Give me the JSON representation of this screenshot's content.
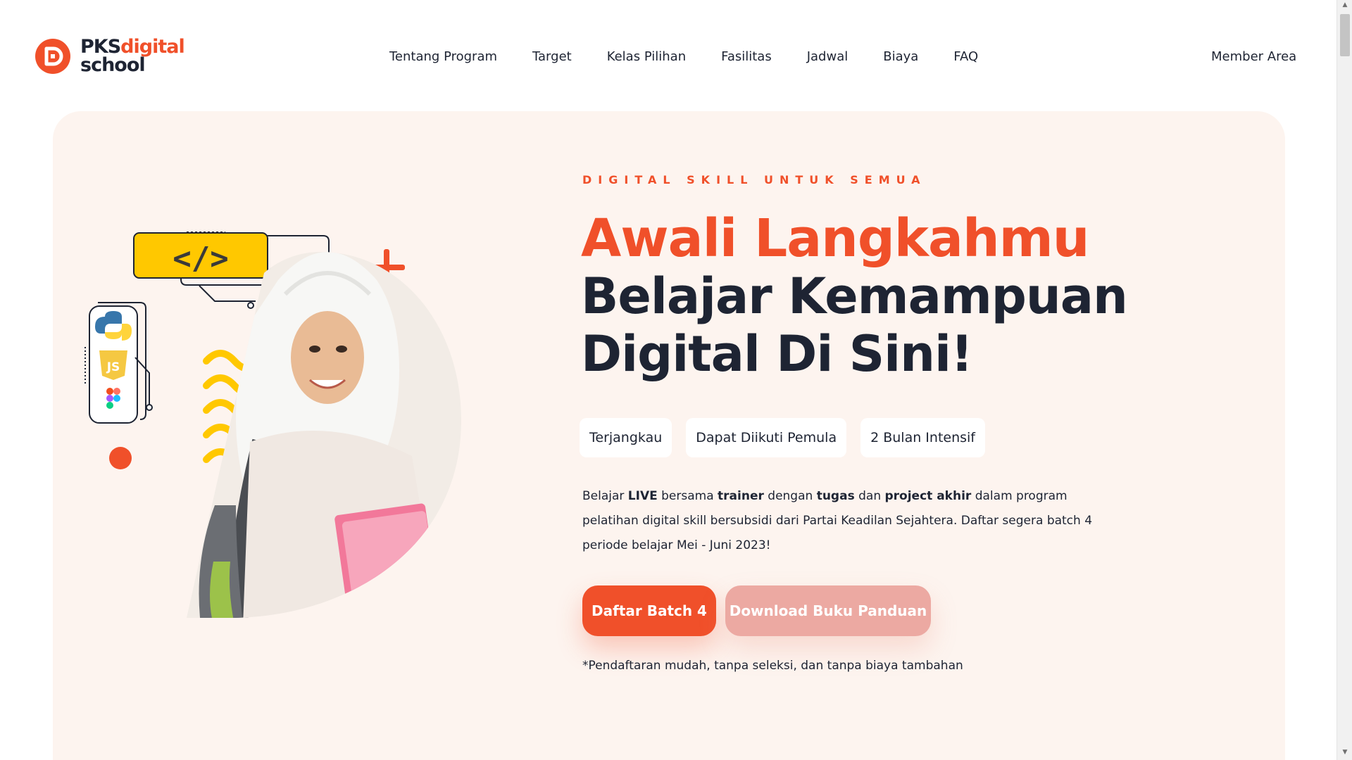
{
  "header": {
    "logo": {
      "line1_a": "PKS",
      "line1_b": "digital",
      "line2": "school"
    },
    "nav": [
      {
        "label": "Tentang Program"
      },
      {
        "label": "Target"
      },
      {
        "label": "Kelas Pilihan"
      },
      {
        "label": "Fasilitas"
      },
      {
        "label": "Jadwal"
      },
      {
        "label": "Biaya"
      },
      {
        "label": "FAQ"
      }
    ],
    "member_area": "Member Area"
  },
  "hero": {
    "eyebrow": "DIGITAL SKILL UNTUK SEMUA",
    "headline_1": "Awali Langkahmu",
    "headline_2": "Belajar Kemampuan",
    "headline_3": "Digital Di Sini!",
    "chips": [
      {
        "label": "Terjangkau"
      },
      {
        "label": "Dapat Diikuti Pemula"
      },
      {
        "label": "2 Bulan Intensif"
      }
    ],
    "description": {
      "t1": "Belajar ",
      "b1": "LIVE",
      "t2": " bersama ",
      "b2": "trainer",
      "t3": " dengan ",
      "b3": "tugas",
      "t4": " dan ",
      "b4": "project akhir",
      "t5": " dalam program pelatihan digital skill bersubsidi dari Partai Keadilan Sejahtera. Daftar segera batch 4 periode belajar Mei - Juni 2023!"
    },
    "primary_button": "Daftar Batch 4",
    "secondary_button": "Download Buku Panduan",
    "note": "*Pendaftaran mudah, tanpa seleksi, dan tanpa biaya tambahan",
    "illustration": {
      "code_icon_text": "</>",
      "js_badge_text": "JS"
    }
  },
  "colors": {
    "accent": "#f0502a",
    "dark": "#1e2433",
    "hero_bg": "#fdf4ef",
    "yellow": "#ffc800"
  },
  "icons": [
    "logo-mark-icon",
    "code-icon",
    "plus-icon",
    "python-icon",
    "javascript-icon",
    "figma-icon",
    "wave-decoration",
    "dot-decoration"
  ]
}
